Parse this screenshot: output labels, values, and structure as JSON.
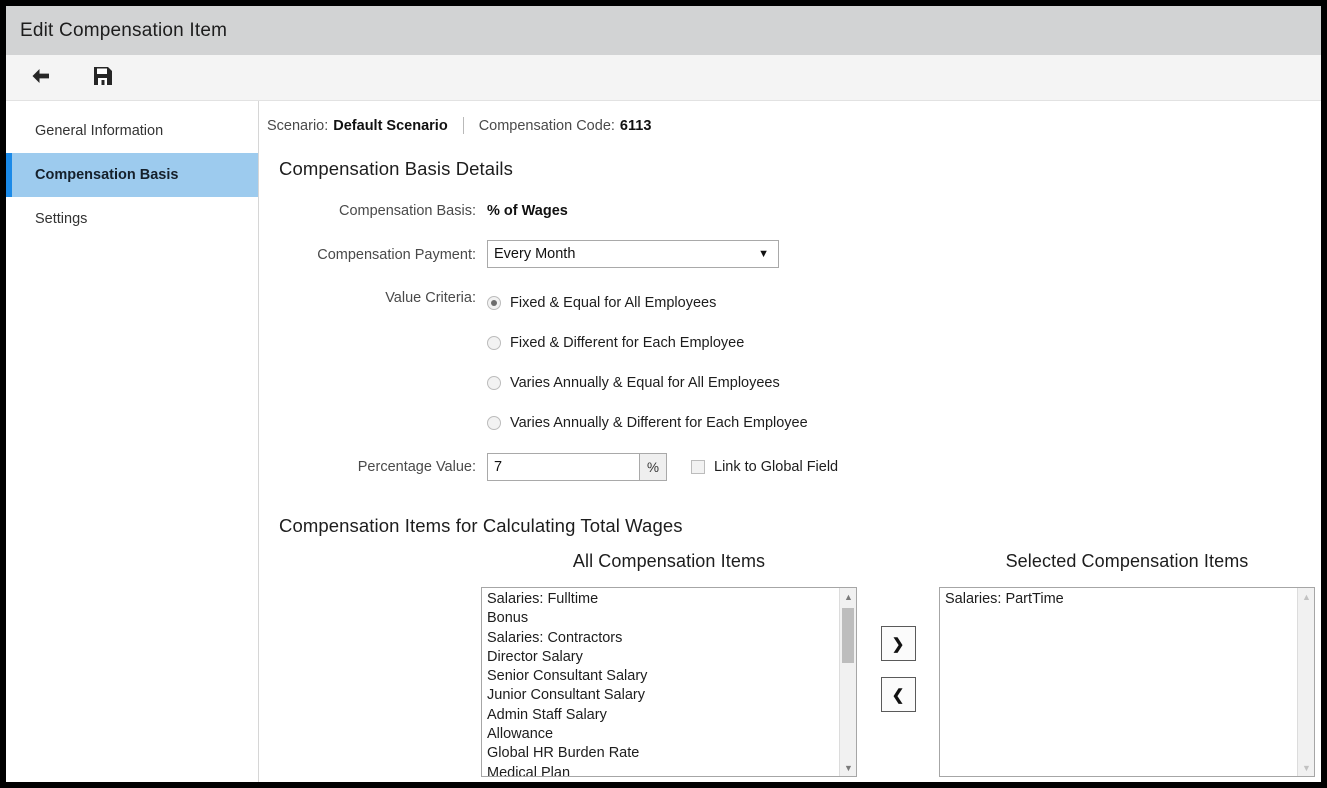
{
  "window": {
    "title": "Edit Compensation Item"
  },
  "toolbar": {
    "back_label": "back-arrow",
    "save_label": "save-disk"
  },
  "sidebar": {
    "items": [
      {
        "label": "General Information",
        "active": false
      },
      {
        "label": "Compensation Basis",
        "active": true
      },
      {
        "label": "Settings",
        "active": false
      }
    ]
  },
  "breadcrumb": {
    "scenario_label": "Scenario:",
    "scenario_value": "Default Scenario",
    "code_label": "Compensation Code:",
    "code_value": "6113"
  },
  "details": {
    "heading": "Compensation Basis Details",
    "basis_label": "Compensation Basis:",
    "basis_value": "% of Wages",
    "payment_label": "Compensation Payment:",
    "payment_value": "Every Month",
    "payment_options": [
      "Every Month"
    ],
    "criteria_label": "Value Criteria:",
    "criteria_options": [
      {
        "label": "Fixed & Equal for All Employees",
        "checked": true
      },
      {
        "label": "Fixed & Different for Each Employee",
        "checked": false
      },
      {
        "label": "Varies Annually & Equal for All Employees",
        "checked": false
      },
      {
        "label": "Varies Annually & Different for Each Employee",
        "checked": false
      }
    ],
    "percentage_label": "Percentage Value:",
    "percentage_value": "7",
    "percentage_unit": "%",
    "link_global_label": "Link to Global Field",
    "link_global_checked": false
  },
  "items_section": {
    "heading": "Compensation Items for Calculating Total Wages",
    "all_title": "All Compensation Items",
    "selected_title": "Selected Compensation Items",
    "all_items": [
      "Salaries: Fulltime",
      "Bonus",
      "Salaries: Contractors",
      "Director Salary",
      "Senior Consultant Salary",
      "Junior Consultant Salary",
      "Admin Staff Salary",
      "Allowance",
      "Global HR Burden Rate",
      "Medical Plan"
    ],
    "selected_items": [
      "Salaries: PartTime"
    ],
    "move_right_label": "❯",
    "move_left_label": "❮"
  },
  "colors": {
    "titlebar_bg": "#d2d3d4",
    "toolbar_bg": "#f4f4f4",
    "sidebar_active_bg": "#9dcbee",
    "sidebar_accent": "#1b8ae8"
  }
}
